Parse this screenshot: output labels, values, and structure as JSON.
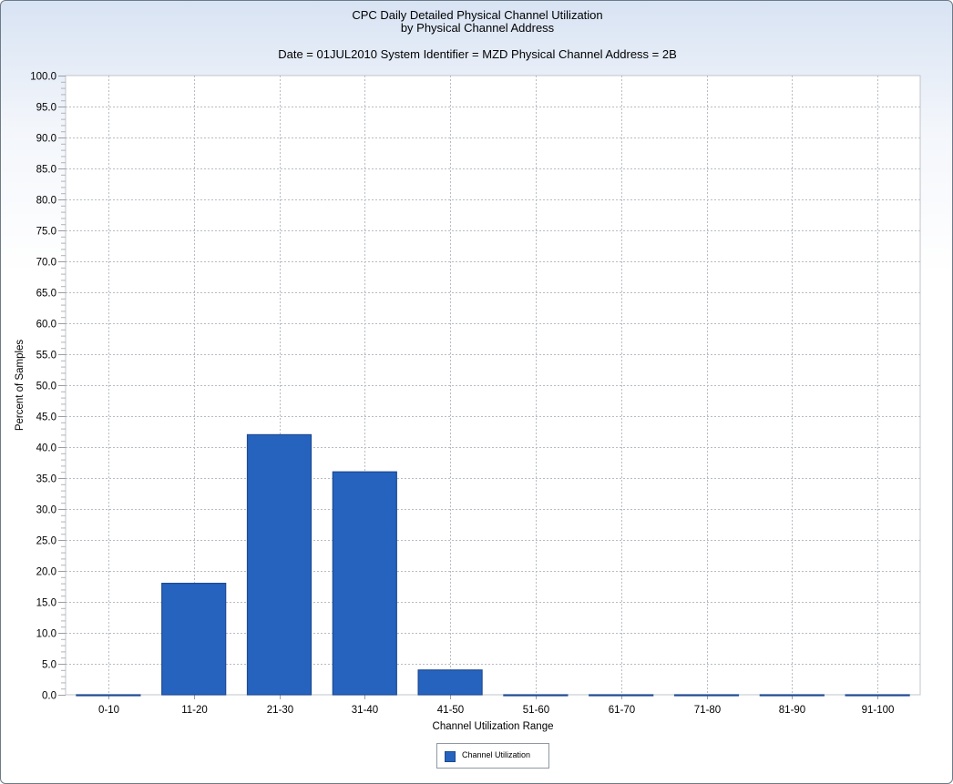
{
  "chart_data": {
    "type": "bar",
    "title": "CPC Daily Detailed Physical Channel Utilization",
    "title_line2": "by Physical Channel Address",
    "subtitle": "Date = 01JUL2010 System Identifier = MZD Physical Channel Address = 2B",
    "xlabel": "Channel Utilization Range",
    "ylabel": "Percent of Samples",
    "categories": [
      "0-10",
      "11-20",
      "21-30",
      "31-40",
      "41-50",
      "51-60",
      "61-70",
      "71-80",
      "81-90",
      "91-100"
    ],
    "series": [
      {
        "name": "Channel Utilization",
        "values": [
          0,
          18,
          42,
          36,
          4,
          0,
          0,
          0,
          0,
          0
        ],
        "color": "#2563bf"
      }
    ],
    "ylim": [
      0,
      100
    ],
    "ytick_step": 5,
    "grid": true,
    "legend": "bottom-center"
  }
}
